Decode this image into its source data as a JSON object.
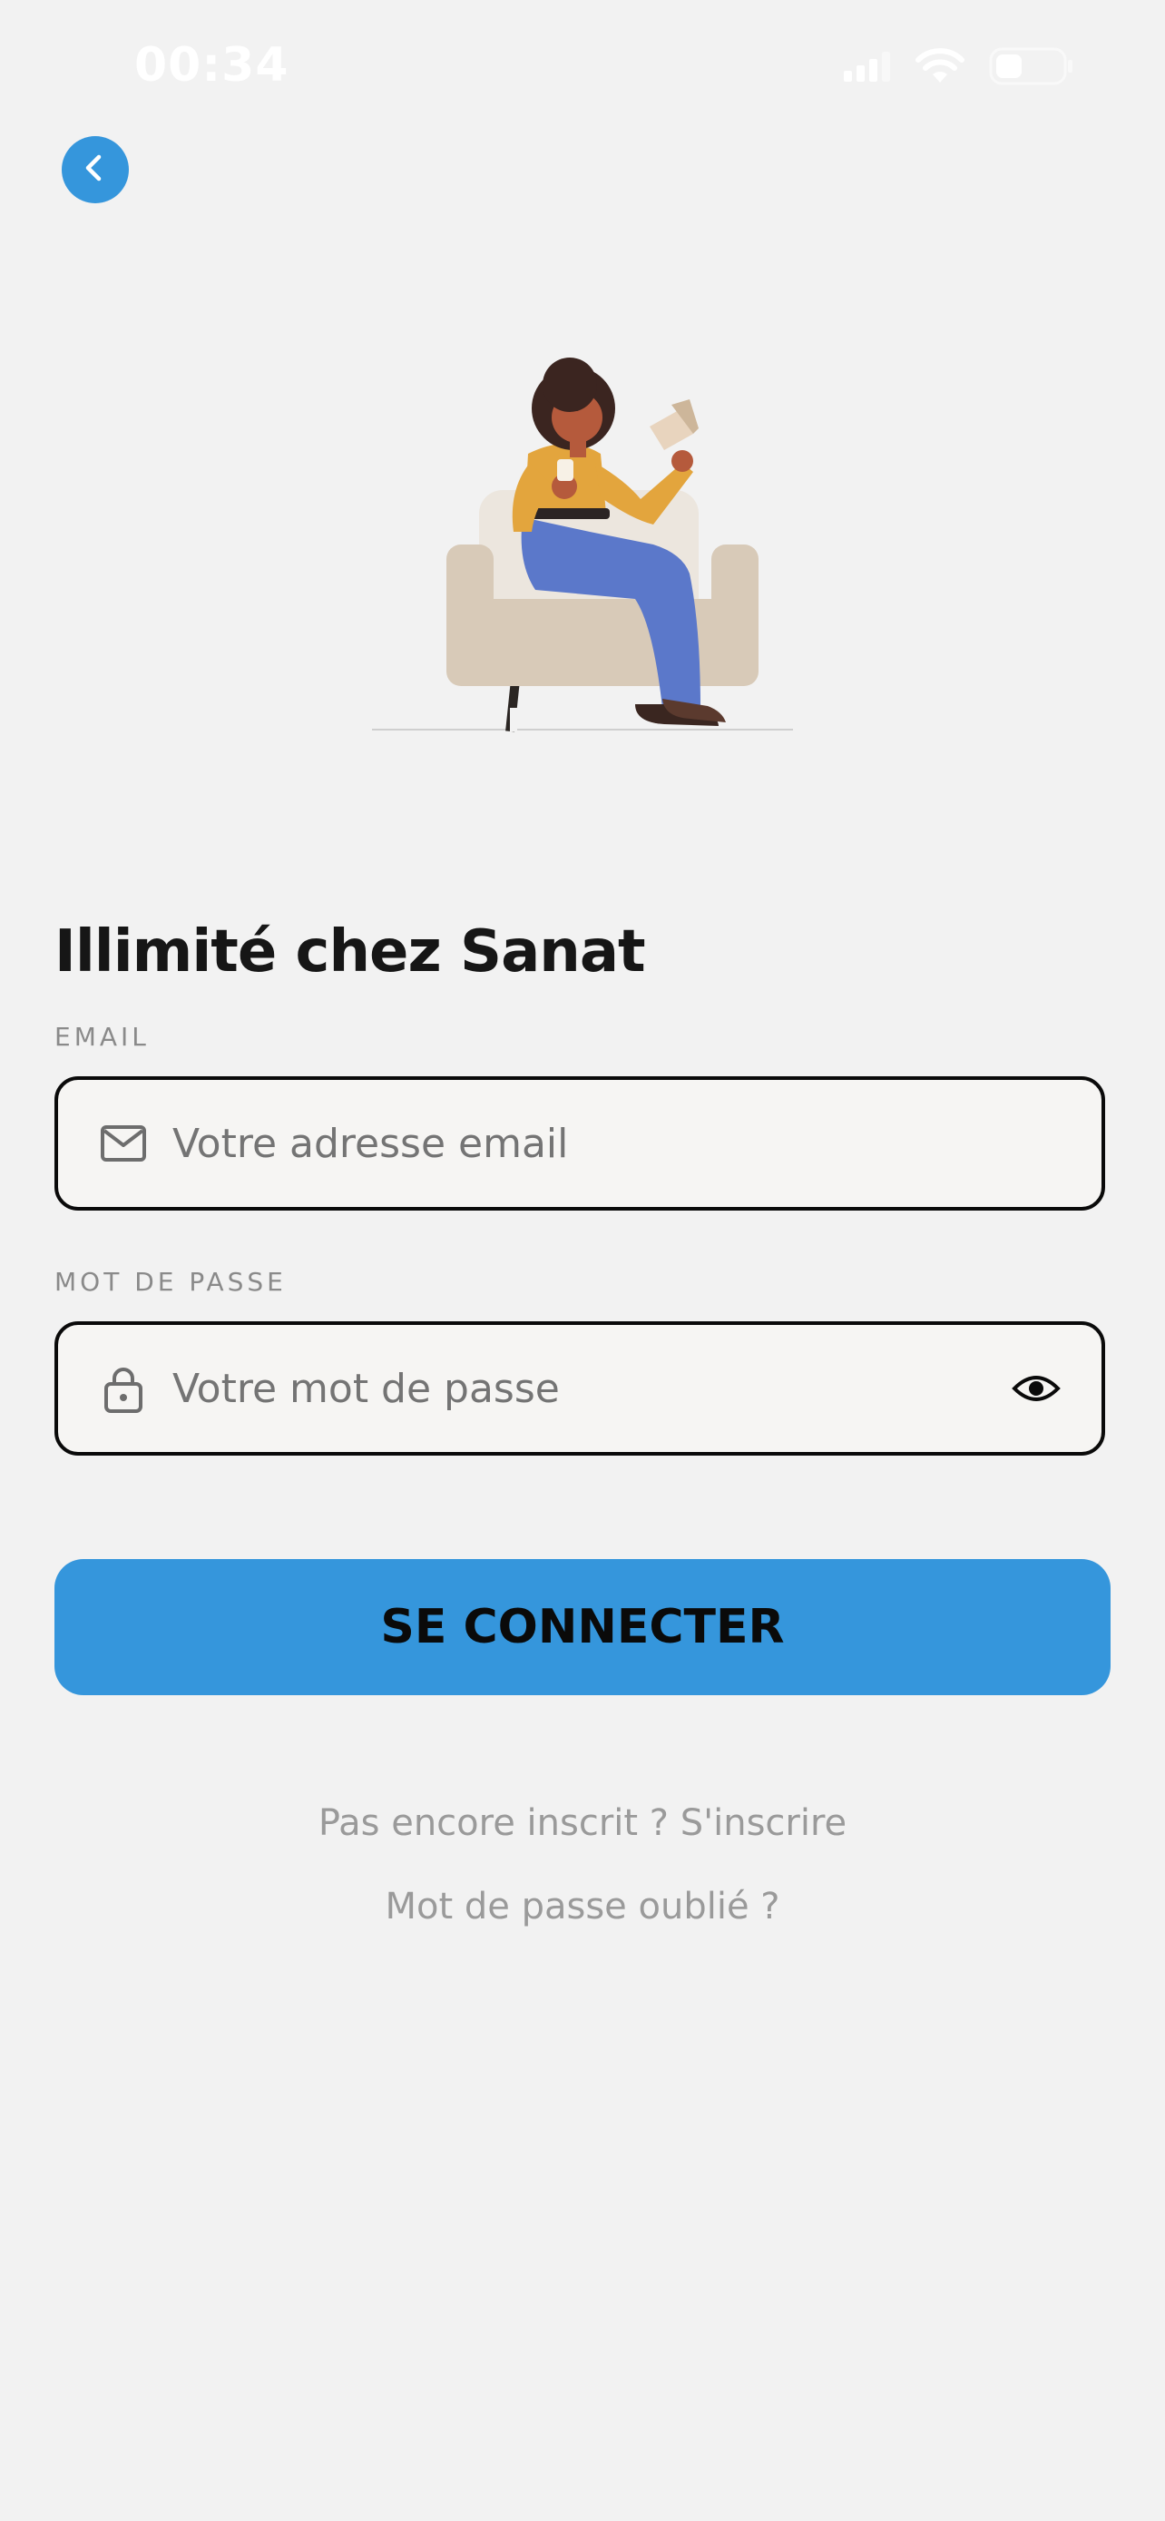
{
  "status_bar": {
    "time": "00:34",
    "signal_icon": "cellular-signal-icon",
    "wifi_icon": "wifi-icon",
    "battery_icon": "battery-icon",
    "colors": {
      "text": "#ffffff"
    }
  },
  "header": {
    "back_icon": "chevron-left-icon",
    "back_color": "#3596dc"
  },
  "illustration": {
    "icon": "woman-reading-in-armchair-illustration"
  },
  "login": {
    "title": "Illimité chez Sanat",
    "email": {
      "label": "EMAIL",
      "placeholder": "Votre adresse email",
      "value": "",
      "icon": "envelope-icon"
    },
    "password": {
      "label": "MOT DE PASSE",
      "placeholder": "Votre mot de passe",
      "value": "",
      "icon": "lock-icon",
      "toggle_icon": "eye-icon"
    },
    "submit_label": "SE CONNECTER",
    "signup_link": "Pas encore inscrit ? S'inscrire",
    "forgot_link": "Mot de passe oublié ?"
  },
  "colors": {
    "accent": "#3596dc",
    "background": "#f2f2f2",
    "input_background": "#f6f5f3",
    "muted_text": "#9a9a9a"
  }
}
